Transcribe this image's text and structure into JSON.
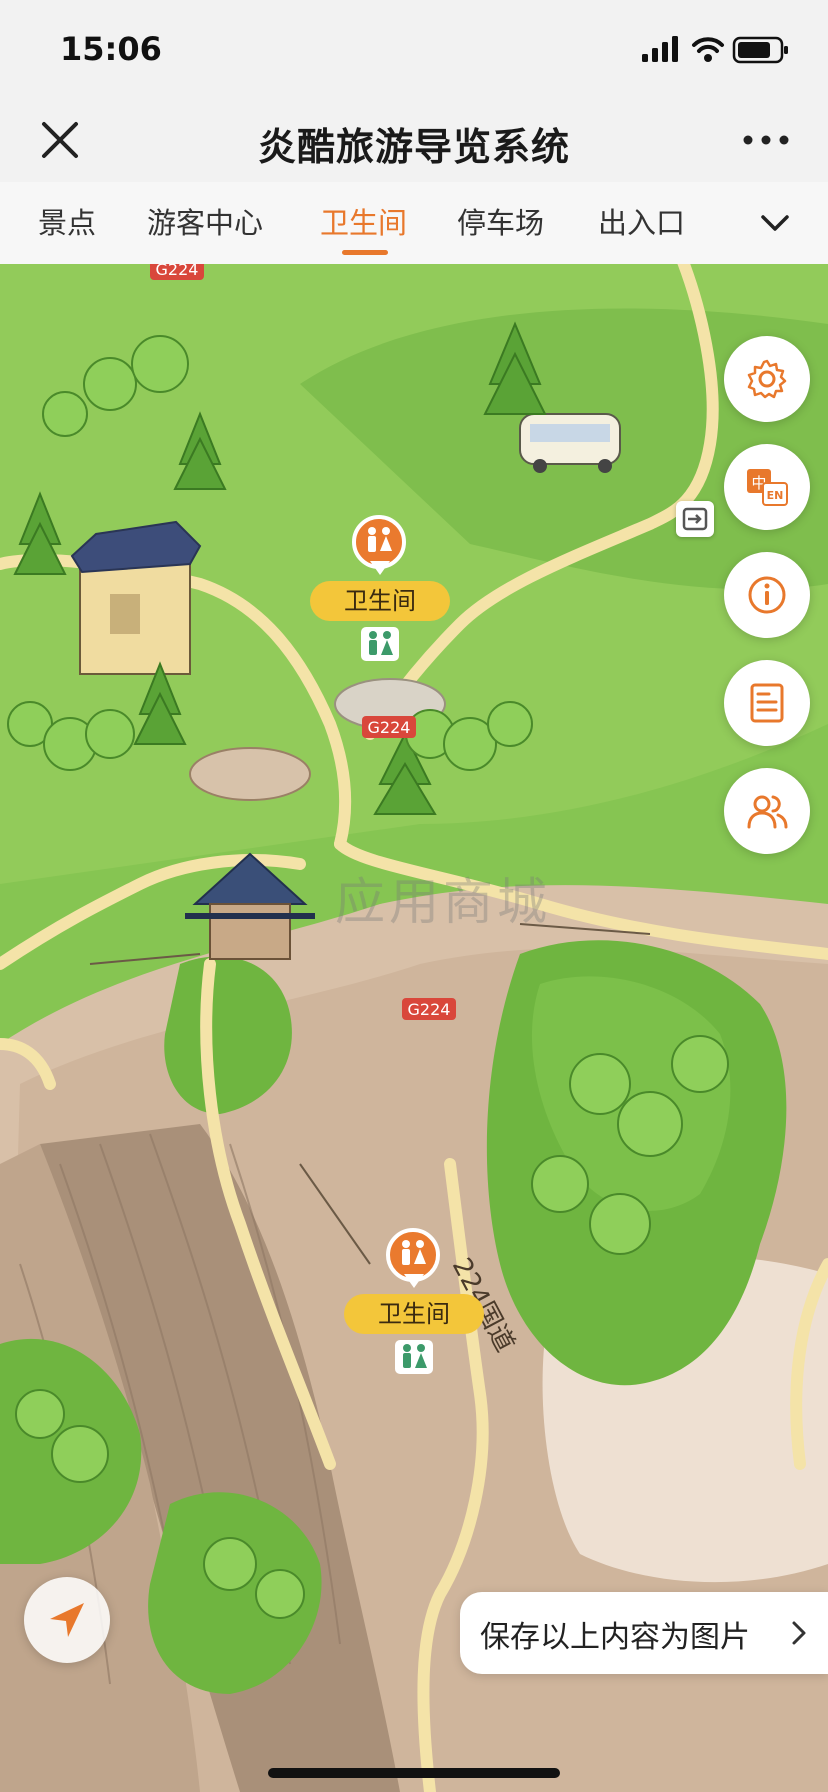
{
  "status": {
    "time": "15:06"
  },
  "nav": {
    "title": "炎酷旅游导览系统"
  },
  "tabs": [
    {
      "label": "景点",
      "active": false
    },
    {
      "label": "游客中心",
      "active": false
    },
    {
      "label": "卫生间",
      "active": true
    },
    {
      "label": "停车场",
      "active": false
    },
    {
      "label": "出入口",
      "active": false
    }
  ],
  "map": {
    "road_labels": [
      "G224",
      "G224",
      "G224",
      "224国道"
    ],
    "pins": [
      {
        "label": "卫生间",
        "icon": "restroom-icon"
      },
      {
        "label": "卫生间",
        "icon": "restroom-icon"
      }
    ],
    "watermark": "应用商城"
  },
  "side_buttons": [
    {
      "name": "settings",
      "icon": "gear-icon"
    },
    {
      "name": "language",
      "icon": "language-icon",
      "text_zh": "中",
      "text_en": "EN"
    },
    {
      "name": "info",
      "icon": "info-icon"
    },
    {
      "name": "notes",
      "icon": "document-icon"
    },
    {
      "name": "group",
      "icon": "users-icon"
    }
  ],
  "save": {
    "label": "保存以上内容为图片"
  },
  "colors": {
    "accent": "#e8782c",
    "pin_label_bg": "#f3c63a",
    "grass": "#7cc04a",
    "rock": "#d9c3ad",
    "road": "#f4e3a8"
  }
}
